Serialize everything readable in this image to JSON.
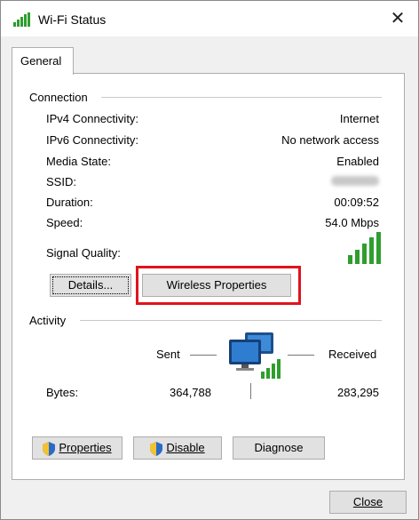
{
  "window": {
    "title": "Wi-Fi Status",
    "close_glyph": "✕"
  },
  "tabs": [
    {
      "label": "General"
    }
  ],
  "connection": {
    "heading": "Connection",
    "rows": [
      {
        "label": "IPv4 Connectivity:",
        "value": "Internet"
      },
      {
        "label": "IPv6 Connectivity:",
        "value": "No network access"
      },
      {
        "label": "Media State:",
        "value": "Enabled"
      },
      {
        "label": "SSID:",
        "value": ""
      },
      {
        "label": "Duration:",
        "value": "00:09:52"
      },
      {
        "label": "Speed:",
        "value": "54.0 Mbps"
      }
    ],
    "signal_label": "Signal Quality:",
    "signal_bars_filled": 5,
    "signal_bars_total": 5,
    "details_button": "Details...",
    "wireless_properties_button": "Wireless Properties"
  },
  "activity": {
    "heading": "Activity",
    "sent_label": "Sent",
    "received_label": "Received",
    "bytes_label": "Bytes:",
    "bytes_sent": "364,788",
    "bytes_received": "283,295"
  },
  "actions": {
    "properties_button": "Properties",
    "disable_button": "Disable",
    "diagnose_button": "Diagnose"
  },
  "footer": {
    "close_button": "Close"
  },
  "colors": {
    "signal_green": "#2e9e2e",
    "highlight_red": "#e0141e",
    "shield_blue": "#2a6ac8",
    "shield_yellow": "#f2c230"
  }
}
